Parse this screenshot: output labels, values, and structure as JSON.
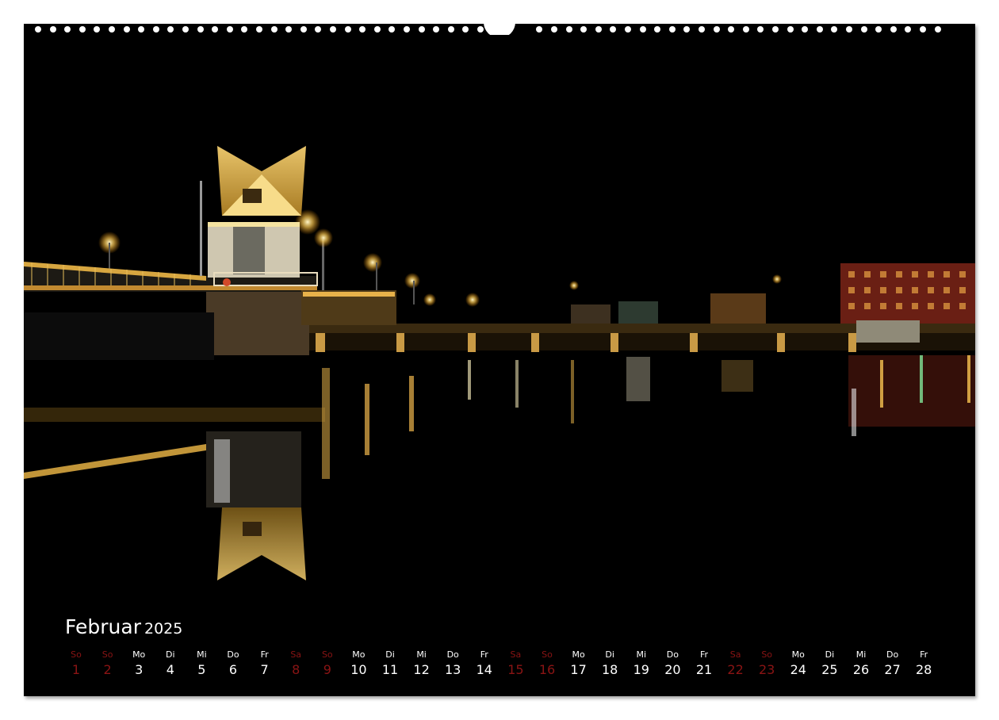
{
  "calendar": {
    "month": "Februar",
    "year": "2025",
    "weekend_color": "#8a1414",
    "text_color": "#ffffff",
    "days": [
      {
        "wd": "So",
        "d": "1",
        "we": true
      },
      {
        "wd": "So",
        "d": "2",
        "we": true
      },
      {
        "wd": "Mo",
        "d": "3",
        "we": false
      },
      {
        "wd": "Di",
        "d": "4",
        "we": false
      },
      {
        "wd": "Mi",
        "d": "5",
        "we": false
      },
      {
        "wd": "Do",
        "d": "6",
        "we": false
      },
      {
        "wd": "Fr",
        "d": "7",
        "we": false
      },
      {
        "wd": "Sa",
        "d": "8",
        "we": true
      },
      {
        "wd": "So",
        "d": "9",
        "we": true
      },
      {
        "wd": "Mo",
        "d": "10",
        "we": false
      },
      {
        "wd": "Di",
        "d": "11",
        "we": false
      },
      {
        "wd": "Mi",
        "d": "12",
        "we": false
      },
      {
        "wd": "Do",
        "d": "13",
        "we": false
      },
      {
        "wd": "Fr",
        "d": "14",
        "we": false
      },
      {
        "wd": "Sa",
        "d": "15",
        "we": true
      },
      {
        "wd": "So",
        "d": "16",
        "we": true
      },
      {
        "wd": "Mo",
        "d": "17",
        "we": false
      },
      {
        "wd": "Di",
        "d": "18",
        "we": false
      },
      {
        "wd": "Mi",
        "d": "19",
        "we": false
      },
      {
        "wd": "Do",
        "d": "20",
        "we": false
      },
      {
        "wd": "Fr",
        "d": "21",
        "we": false
      },
      {
        "wd": "Sa",
        "d": "22",
        "we": true
      },
      {
        "wd": "So",
        "d": "23",
        "we": true
      },
      {
        "wd": "Mo",
        "d": "24",
        "we": false
      },
      {
        "wd": "Di",
        "d": "25",
        "we": false
      },
      {
        "wd": "Mi",
        "d": "26",
        "we": false
      },
      {
        "wd": "Do",
        "d": "27",
        "we": false
      },
      {
        "wd": "Fr",
        "d": "28",
        "we": false
      }
    ]
  }
}
